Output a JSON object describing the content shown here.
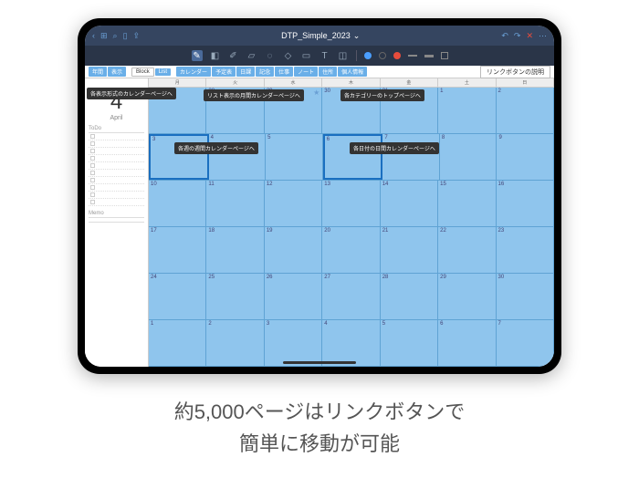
{
  "topbar": {
    "title": "DTP_Simple_2023",
    "dropdown": "⌄"
  },
  "tabs": {
    "group1": [
      "年間",
      "表示"
    ],
    "block": "Block",
    "list": "List",
    "group2": [
      "カレンダー",
      "予定表",
      "日課",
      "記念",
      "仕事",
      "ノート",
      "住所",
      "個人情報"
    ],
    "linkHelp": "リンクボタンの説明"
  },
  "sidebar": {
    "dayNum": "4",
    "month": "April",
    "todoLabel": "ToDo",
    "memoLabel": "Memo"
  },
  "calendar": {
    "headers": [
      "月",
      "火",
      "水",
      "木",
      "金",
      "土",
      "日"
    ],
    "weeks": [
      [
        "27",
        "28",
        "29",
        "30",
        "31",
        "1",
        "2"
      ],
      [
        "3",
        "4",
        "5",
        "6",
        "7",
        "8",
        "9"
      ],
      [
        "10",
        "11",
        "12",
        "13",
        "14",
        "15",
        "16"
      ],
      [
        "17",
        "18",
        "19",
        "20",
        "21",
        "22",
        "23"
      ],
      [
        "24",
        "25",
        "26",
        "27",
        "28",
        "29",
        "30"
      ],
      [
        "1",
        "2",
        "3",
        "4",
        "5",
        "6",
        "7"
      ]
    ]
  },
  "callouts": {
    "displayFormat": "各表示形式のカレンダーページへ",
    "monthList": "リスト表示の月間カレンダーページへ",
    "categoryTop": "各カテゴリーのトップページへ",
    "weekly": "各週の週間カレンダーページへ",
    "daily": "各日付の日間カレンダーページへ"
  },
  "caption": {
    "line1": "約5,000ページはリンクボタンで",
    "line2": "簡単に移動が可能"
  }
}
